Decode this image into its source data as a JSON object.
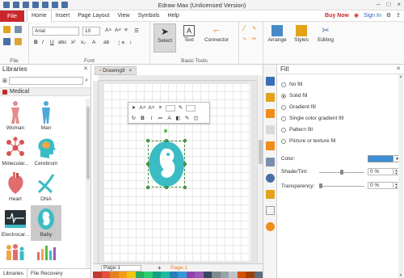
{
  "app": {
    "title": "Edraw Max (Unlicensed Version)"
  },
  "menu": {
    "file": "File",
    "tabs": [
      "Home",
      "Insert",
      "Page Layout",
      "View",
      "Symbols",
      "Help"
    ],
    "buy_now": "Buy Now",
    "sign_in": "Sign In"
  },
  "ribbon": {
    "file_group": "File",
    "font_group": "Font",
    "tools_group": "Basic Tools",
    "font_name": "Arial",
    "font_size": "10",
    "select": "Select",
    "text": "Text",
    "connector": "Connector",
    "arrange": "Arrange",
    "styles": "Styles",
    "editing": "Editing"
  },
  "libraries": {
    "title": "Libraries",
    "category": "Medical",
    "shapes": [
      "Woman",
      "Man",
      "Molecular...",
      "Cerebrum",
      "Heart",
      "DNA",
      "Electrocar...",
      "Baby"
    ],
    "selected_shape": "Baby",
    "footer_tabs": [
      "Libraries",
      "File Recovery"
    ]
  },
  "document": {
    "tab": "Drawing9",
    "page_select": "Page-1",
    "add_page": "+",
    "page_tab": "Page-1"
  },
  "fill_panel": {
    "title": "Fill",
    "options": [
      "No fill",
      "Solid fill",
      "Gradient fill",
      "Single color gradient fill",
      "Pattern fill",
      "Picture or texture fill"
    ],
    "selected": "Solid fill",
    "color_label": "Color:",
    "shade_label": "Shade/Tint:",
    "shade_value": "0 %",
    "transparency_label": "Transparency:",
    "transparency_value": "0 %",
    "color": "#3a8fd8"
  },
  "colors": {
    "brand_red": "#c8282c",
    "shape_teal": "#3bbcc4",
    "selection_green": "#57b849"
  }
}
